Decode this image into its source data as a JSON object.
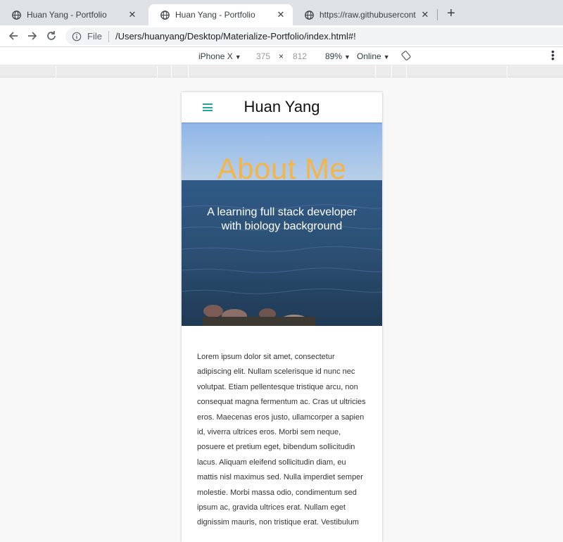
{
  "browser": {
    "tabs": [
      {
        "title": "Huan Yang - Portfolio",
        "active": false
      },
      {
        "title": "Huan Yang - Portfolio",
        "active": true
      },
      {
        "title": "https://raw.githubusercontent.c",
        "active": false
      }
    ],
    "address": {
      "scheme_label": "File",
      "url": "/Users/huanyang/Desktop/Materialize-Portfolio/index.html#!"
    }
  },
  "device_toolbar": {
    "device": "iPhone X",
    "width": "375",
    "times": "×",
    "height": "812",
    "zoom": "89%",
    "network": "Online"
  },
  "page": {
    "brand": "Huan Yang",
    "hero": {
      "title": "About Me",
      "subtitle": "A learning full stack developer with biology background"
    },
    "body_text": "Lorem ipsum dolor sit amet, consectetur adipiscing elit. Nullam scelerisque id nunc nec volutpat. Etiam pellentesque tristique arcu, non consequat magna fermentum ac. Cras ut ultricies eros. Maecenas eros justo, ullamcorper a sapien id, viverra ultrices eros. Morbi sem neque, posuere et pretium eget, bibendum sollicitudin lacus. Aliquam eleifend sollicitudin diam, eu mattis nisl maximus sed. Nulla imperdiet semper molestie. Morbi massa odio, condimentum sed ipsum ac, gravida ultrices erat. Nullam eget dignissim mauris, non tristique erat. Vestibulum"
  },
  "colors": {
    "accent": "#26a69a",
    "hero_title": "#f3b54a"
  }
}
